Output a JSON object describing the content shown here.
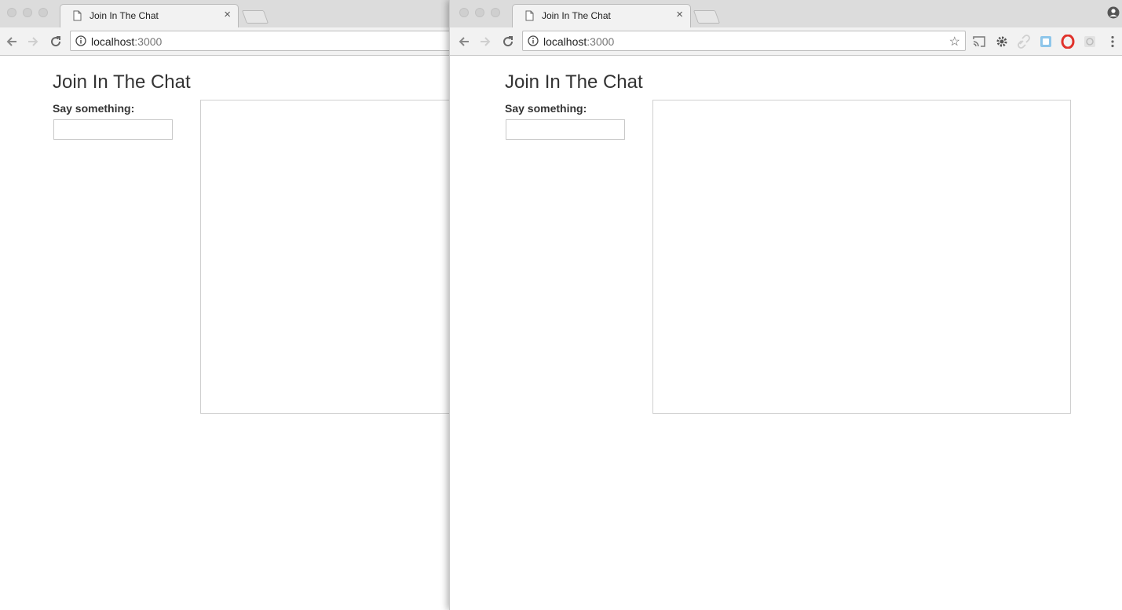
{
  "tab": {
    "title": "Join In The Chat"
  },
  "omnibox": {
    "host": "localhost",
    "port": ":3000"
  },
  "page": {
    "title": "Join In The Chat",
    "say_label": "Say something:",
    "message_value": "",
    "chat_messages": []
  }
}
